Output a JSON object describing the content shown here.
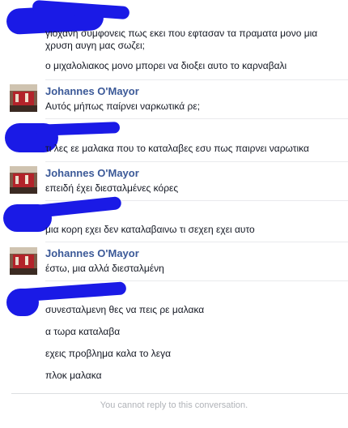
{
  "conversation": {
    "groups": [
      {
        "sender": "",
        "messages": [
          "γιοχανη συμφονεις πως εκει που εφτασαν τα πραματα μονο μια",
          "χρυση αυγη μας σωζει;",
          "ο μιχαλολιακος μονο μπορει να διοξει αυτο το καρναβαλι"
        ]
      },
      {
        "sender": "Johannes O'Mayor",
        "messages": [
          "Αυτός μήπως παίρνει ναρκωτικά ρε;"
        ]
      },
      {
        "sender": "",
        "messages": [
          "τι λες εε μαλακα που το καταλαβες εσυ πως παιρνει ναρωτικα"
        ]
      },
      {
        "sender": "Johannes O'Mayor",
        "messages": [
          "επειδή έχει διεσταλμένες κόρες"
        ]
      },
      {
        "sender": "",
        "messages": [
          "μια κορη εχει δεν καταλαβαινω τι σεχεη εχει αυτο"
        ]
      },
      {
        "sender": "Johannes O'Mayor",
        "messages": [
          "έστω, μια αλλά διεσταλμένη"
        ]
      },
      {
        "sender": "",
        "messages": [
          "συνεσταλμενη θες να πεις ρε μαλακα",
          "α τωρα καταλαβα",
          "εχεις προβλημα καλα το λεγα",
          "πλοκ μαλακα"
        ]
      }
    ],
    "footer_notice": "You cannot reply to this conversation.",
    "colors": {
      "sender_name": "#3b5998",
      "message_text": "#141823",
      "redaction_scribble": "#1a1ae6",
      "footer_text": "#b0b3b8"
    }
  }
}
